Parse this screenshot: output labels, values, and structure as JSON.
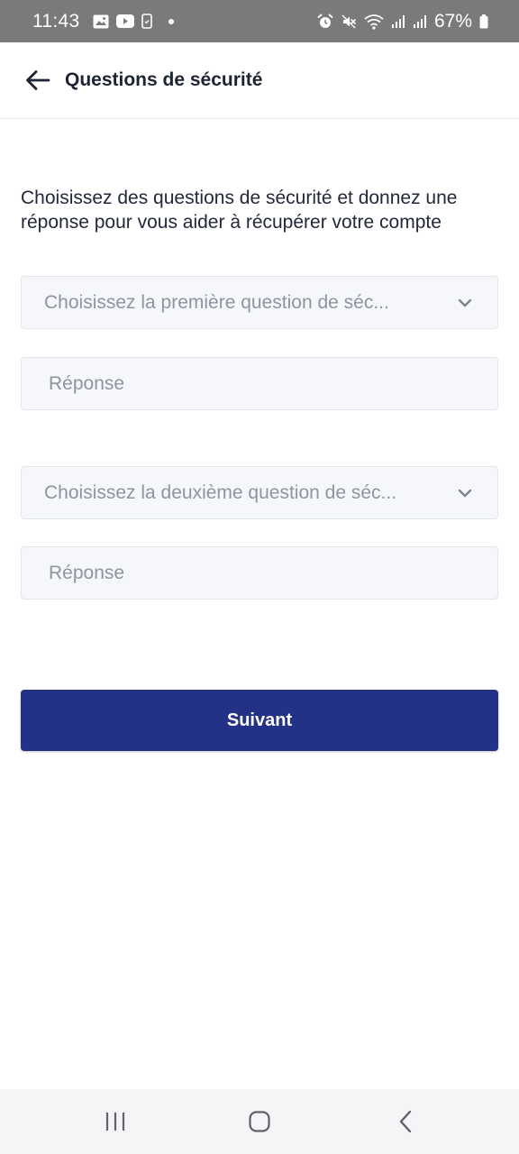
{
  "status_bar": {
    "time": "11:43",
    "battery": "67%",
    "icons": [
      "gallery-icon",
      "youtube-icon",
      "clipboard-icon",
      "alarm-icon",
      "mute-icon",
      "wifi-icon",
      "signal-icon",
      "signal-icon",
      "battery-icon"
    ]
  },
  "header": {
    "back_icon": "arrow-left-icon",
    "title": "Questions de sécurité"
  },
  "description": "Choisissez des questions de sécurité et donnez une réponse pour vous aider à récupérer votre compte",
  "form": {
    "question1": {
      "placeholder": "Choisissez la première question de séc...",
      "icon": "chevron-down-icon"
    },
    "answer1": {
      "placeholder": "Réponse",
      "value": ""
    },
    "question2": {
      "placeholder": "Choisissez la deuxième question de séc...",
      "icon": "chevron-down-icon"
    },
    "answer2": {
      "placeholder": "Réponse",
      "value": ""
    },
    "submit_label": "Suivant"
  },
  "nav_bar": {
    "icons": [
      "recents-icon",
      "home-icon",
      "back-icon"
    ]
  },
  "colors": {
    "primary": "#233186",
    "status_bar": "#7a7a7a",
    "field_background": "#f6f7fa",
    "placeholder": "#8e94a0"
  }
}
